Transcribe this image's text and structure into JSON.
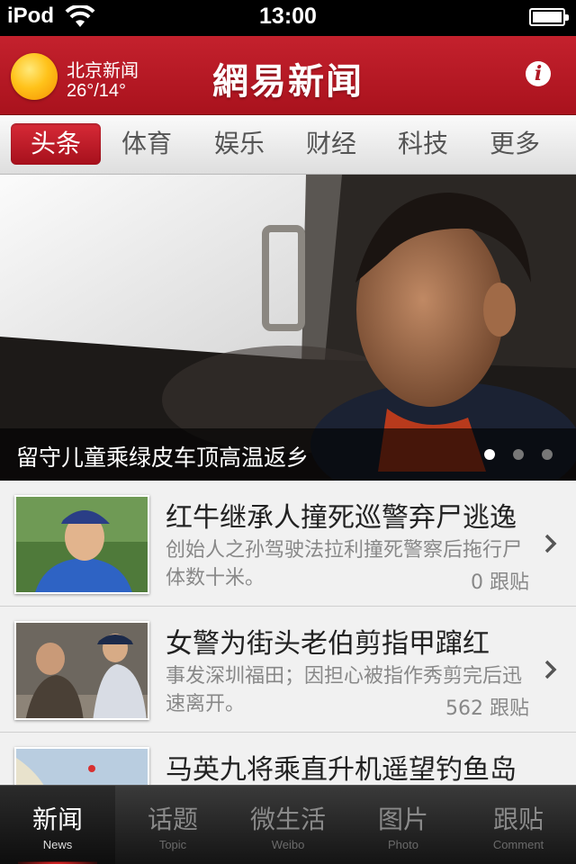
{
  "status_bar": {
    "carrier": "iPod",
    "time": "13:00"
  },
  "header": {
    "weather_city": "北京新闻",
    "weather_temp": "26°/14°",
    "app_title": "網易新闻",
    "info_label": "i"
  },
  "tabs": [
    {
      "label": "头条",
      "active": true
    },
    {
      "label": "体育",
      "active": false
    },
    {
      "label": "娱乐",
      "active": false
    },
    {
      "label": "财经",
      "active": false
    },
    {
      "label": "科技",
      "active": false
    },
    {
      "label": "更多",
      "active": false
    }
  ],
  "hero": {
    "caption": "留守儿童乘绿皮车顶高温返乡",
    "page_count": 3,
    "current_page": 1
  },
  "news": [
    {
      "title": "红牛继承人撞死巡警弃尸逃逸",
      "summary": "创始人之孙驾驶法拉利撞死警察后拖行尸体数十米。",
      "comments": "0 跟贴"
    },
    {
      "title": "女警为街头老伯剪指甲蹿红",
      "summary": "事发深圳福田；因担心被指作秀剪完后迅速离开。",
      "comments": "562 跟贴"
    },
    {
      "title": "马英九将乘直升机遥望钓鱼岛",
      "summary": "",
      "comments": ""
    }
  ],
  "bottom_nav": [
    {
      "label": "新闻",
      "sub": "News",
      "active": true
    },
    {
      "label": "话题",
      "sub": "Topic",
      "active": false
    },
    {
      "label": "微生活",
      "sub": "Weibo",
      "active": false
    },
    {
      "label": "图片",
      "sub": "Photo",
      "active": false
    },
    {
      "label": "跟贴",
      "sub": "Comment",
      "active": false
    }
  ],
  "colors": {
    "brand_red": "#b01824",
    "tab_active": "#c41f2c",
    "nav_bg": "#1e1e1e"
  }
}
